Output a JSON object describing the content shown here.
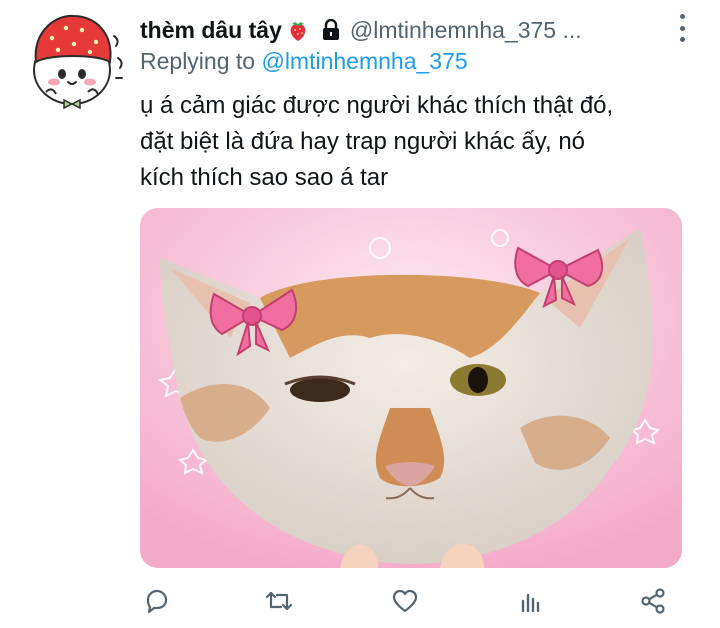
{
  "tweet": {
    "display_name": "thèm dâu tây",
    "name_emoji": "strawberry",
    "protected_icon": "lock-icon",
    "handle": "@lmtinhemnha_375 ...",
    "replying_prefix": "Replying to",
    "replying_to": "@lmtinhemnha_375",
    "text_lines": [
      "ụ á cảm giác được người khác thích thật đó,",
      "đặt biệt là đứa hay trap người khác ấy, nó",
      "kích thích sao sao á tar"
    ]
  },
  "actions": {
    "reply": "reply-icon",
    "retweet": "retweet-icon",
    "like": "heart-icon",
    "views": "analytics-icon",
    "share": "share-icon"
  },
  "colors": {
    "accent": "#1d9bf0",
    "secondary_text": "#536471",
    "primary_text": "#0f1419"
  }
}
